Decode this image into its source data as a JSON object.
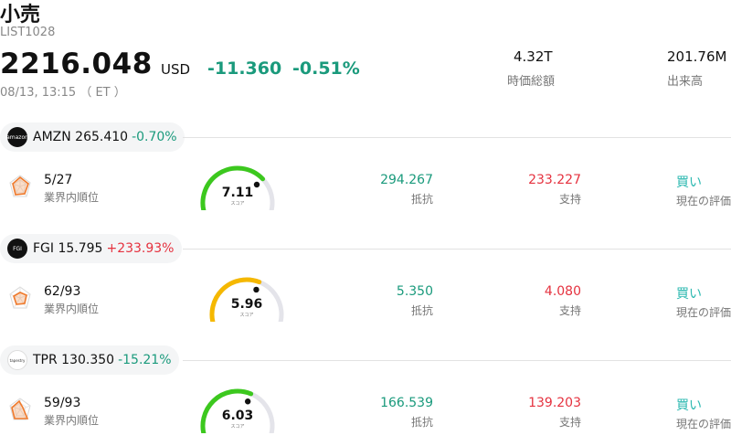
{
  "header": {
    "title": "小売",
    "code": "LIST1028",
    "price": "2216.048",
    "currency": "USD",
    "change": "-11.360",
    "change_pct": "-0.51%",
    "timestamp": "08/13, 13:15 （ ET ）",
    "market_cap_value": "4.32T",
    "market_cap_label": "時価総額",
    "volume_value": "201.76M",
    "volume_label": "出来高"
  },
  "stocks": [
    {
      "logo_text": "amazon",
      "ticker_price": "AMZN 265.410",
      "change_pct": "-0.70%",
      "rank": "5/27",
      "rank_label": "業界内順位",
      "score": "7.11",
      "score_value": 7.11,
      "score_label": "スコア",
      "resistance": "294.267",
      "resistance_label": "抵抗",
      "support": "233.227",
      "support_label": "支持",
      "evaluation": "買い",
      "evaluation_label": "現在の評価"
    },
    {
      "logo_text": "FGI",
      "ticker_price": "FGI 15.795",
      "change_pct": "+233.93%",
      "rank": "62/93",
      "rank_label": "業界内順位",
      "score": "5.96",
      "score_value": 5.96,
      "score_label": "スコア",
      "resistance": "5.350",
      "resistance_label": "抵抗",
      "support": "4.080",
      "support_label": "支持",
      "evaluation": "買い",
      "evaluation_label": "現在の評価"
    },
    {
      "logo_text": "tapestry",
      "ticker_price": "TPR 130.350",
      "change_pct": "-15.21%",
      "rank": "59/93",
      "rank_label": "業界内順位",
      "score": "6.03",
      "score_value": 6.03,
      "score_label": "スコア",
      "resistance": "166.539",
      "resistance_label": "抵抗",
      "support": "139.203",
      "support_label": "支持",
      "evaluation": "買い",
      "evaluation_label": "現在の評価"
    }
  ],
  "colors": {
    "positive": "#1a9a7c",
    "negative": "#e5323f",
    "gauge_green": "#3cc81e",
    "gauge_yellow": "#f5b800",
    "gauge_track": "#e4e4ea",
    "radar": "#f07a2c"
  }
}
